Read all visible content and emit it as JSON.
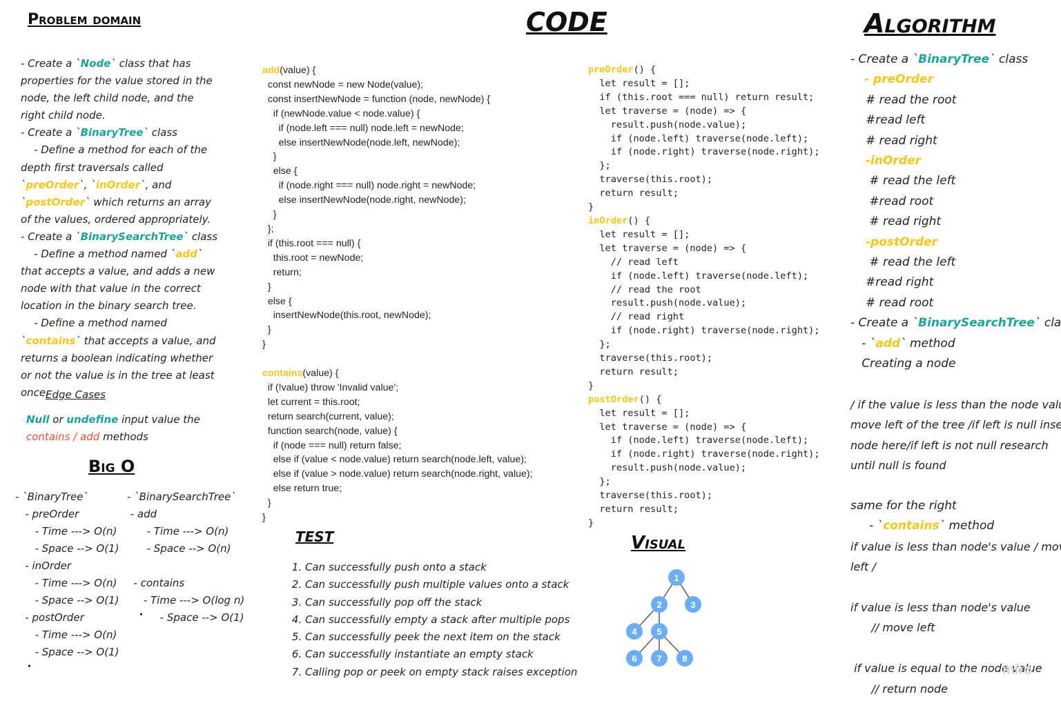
{
  "headings": {
    "problem_domain": "Problem domain",
    "code": "CODE",
    "algorithm": "Algorithm",
    "big_o": "Big O",
    "test": "TEST",
    "visual": "Visual",
    "edge_cases": "Edge Cases"
  },
  "problem_domain": {
    "l1": {
      "a": "- Create a `",
      "b": "Node",
      "c": "` class that has properties for the value stored in the node, the left child node, and the right child node."
    },
    "l2": {
      "a": "- Create a `",
      "b": "BinaryTree",
      "c": "` class"
    },
    "l3": {
      "a": "    - Define a method for each of the depth first traversals called `",
      "b": "preOrder",
      "c": "`, `",
      "d": "inOrder",
      "e": "`, and `",
      "f": "postOrder",
      "g": "` which returns an array of the values, ordered appropriately."
    },
    "l4": {
      "a": "- Create a `",
      "b": "BinarySearchTree",
      "c": "` class"
    },
    "l5": {
      "a": "    - Define a method named `",
      "b": "add",
      "c": "` that accepts a value, and adds a new node with that value in the correct location in the binary search tree."
    },
    "l6": {
      "a": "    - Define a method named `",
      "b": "contains",
      "c": "` that accepts a value, and returns a boolean indicating whether or not the value is in the tree at least once."
    }
  },
  "edge_cases": {
    "null": "Null",
    "or": " or ",
    "undefine": "undefine",
    "rest1": " input value the",
    "methods_red": "contains / add",
    "rest2": " methods"
  },
  "big_o": {
    "left": [
      "- `BinaryTree`",
      "   - preOrder",
      "      - Time ---> O(n)",
      "      - Space --> O(1)",
      "   - inOrder",
      "      - Time ---> O(n)",
      "      - Space --> O(1)",
      "   - postOrder",
      "      - Time ---> O(n)",
      "      - Space --> O(1)"
    ],
    "right": [
      "- `BinarySearchTree`",
      " - add",
      "      - Time ---> O(n)",
      "      - Space --> O(n)",
      "",
      "  - contains",
      "     - Time ---> O(log n)",
      "          - Space --> O(1)"
    ],
    "bullet": "•"
  },
  "code_add": {
    "fn_add": "add",
    "add_lines": [
      "(value) {",
      "  const newNode = new Node(value);",
      "  const insertNewNode = function (node, newNode) {",
      "    if (newNode.value < node.value) {",
      "      if (node.left === null) node.left = newNode;",
      "      else insertNewNode(node.left, newNode);",
      "    }",
      "    else {",
      "      if (node.right === null) node.right = newNode;",
      "      else insertNewNode(node.right, newNode);",
      "    }",
      "  };",
      "  if (this.root === null) {",
      "    this.root = newNode;",
      "    return;",
      "  }",
      "  else {",
      "    insertNewNode(this.root, newNode);",
      "  }",
      "}"
    ],
    "fn_contains": "contains",
    "contains_lines": [
      "(value) {",
      "  if (!value) throw 'Invalid value';",
      "  let current = this.root;",
      "  return search(current, value);",
      "  function search(node, value) {",
      "    if (node === null) return false;",
      "    else if (value < node.value) return search(node.left, value);",
      "    else if (value > node.value) return search(node.right, value);",
      "    else return true;",
      "  }",
      "}"
    ]
  },
  "code_traversals": {
    "pre_name": "preOrder",
    "pre_lines": [
      "() {",
      "  let result = [];",
      "  if (this.root === null) return result;",
      "  let traverse = (node) => {",
      "    result.push(node.value);",
      "    if (node.left) traverse(node.left);",
      "    if (node.right) traverse(node.right);",
      "  };",
      "  traverse(this.root);",
      "  return result;",
      "}"
    ],
    "in_name": "inOrder",
    "in_lines": [
      "() {",
      "  let result = [];",
      "  let traverse = (node) => {",
      "    // read left",
      "    if (node.left) traverse(node.left);",
      "    // read the root",
      "    result.push(node.value);",
      "    // read right",
      "    if (node.right) traverse(node.right);",
      "  };",
      "  traverse(this.root);",
      "  return result;",
      "}"
    ],
    "post_name": "postOrder",
    "post_lines": [
      "() {",
      "  let result = [];",
      "  let traverse = (node) => {",
      "    if (node.left) traverse(node.left);",
      "    if (node.right) traverse(node.right);",
      "    result.push(node.value);",
      "  };",
      "  traverse(this.root);",
      "  return result;",
      "}"
    ]
  },
  "algorithm": {
    "l1": {
      "a": "- Create a `",
      "b": "BinaryTree",
      "c": "` class"
    },
    "pre": "- preOrder",
    "pre_steps": [
      "# read the root",
      "#read left",
      "# read right"
    ],
    "in": "-inOrder",
    "in_steps": [
      " # read the left",
      " #read root",
      " # read right"
    ],
    "post": "-postOrder",
    "post_steps": [
      " # read the left",
      "#read right",
      "# read root"
    ],
    "l2": {
      "a": "- Create a `",
      "b": "BinarySearchTree",
      "c": "` class"
    },
    "add": {
      "a": "   - `",
      "b": "add",
      "c": "` method"
    },
    "creating": "   Creating a node",
    "para1": [
      "/ if the value is less than the node value",
      "move left of the tree /if left is null insert",
      "node here/if left is not null research",
      "until null is found"
    ],
    "same_right": "same for the right",
    "contains": {
      "a": "     - `",
      "b": "contains",
      "c": "` method"
    },
    "para2": [
      "if value is less than node's value / move",
      "left /"
    ],
    "para3": [
      "if value is less than node's value",
      "      // move left"
    ],
    "para4": [
      " if value is equal to the node value",
      "      // return node"
    ]
  },
  "tests": [
    "Can successfully push onto a stack",
    "Can successfully push multiple values onto a stack",
    "Can successfully pop off the stack",
    "Can successfully empty a stack after multiple pops",
    "Can successfully peek the next item on the stack",
    "Can successfully instantiate an empty stack",
    "Calling pop or peek on empty stack raises exception"
  ],
  "visual_tree": {
    "nodes": [
      "1",
      "2",
      "3",
      "4",
      "5",
      "6",
      "7",
      "8"
    ],
    "edges": [
      [
        "1",
        "2"
      ],
      [
        "1",
        "3"
      ],
      [
        "2",
        "4"
      ],
      [
        "2",
        "5"
      ],
      [
        "5",
        "6"
      ],
      [
        "5",
        "7"
      ],
      [
        "5",
        "8"
      ]
    ],
    "node_color": "#6aaef5"
  },
  "watermark": "miro",
  "colors": {
    "yellow": "#f5c518",
    "teal": "#1aa39a",
    "red": "#e8513a"
  }
}
